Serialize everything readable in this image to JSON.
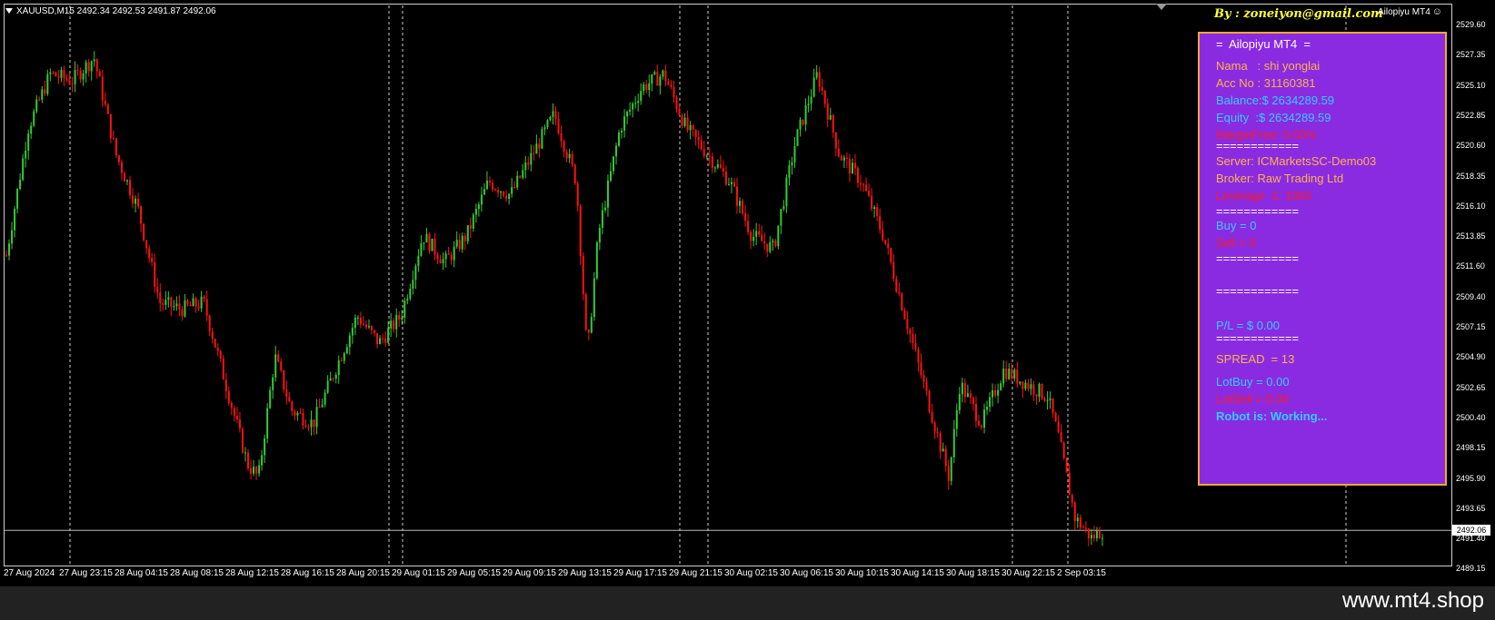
{
  "header": {
    "symbol_info": "XAUUSD,M15  2492.34 2492.53 2491.87 2492.06",
    "ea_name": "Ailopiyu MT4",
    "ea_smile": "☺",
    "by_label": "By : zoneiyon@gmail.com"
  },
  "panel": {
    "title": "=  Ailopiyu MT4  =",
    "nama": "Nama   : shi yonglai",
    "acc_no": "Acc No : 31160381",
    "balance": "Balance:$ 2634289.59",
    "equity": "Equity  :$ 2634289.59",
    "margin_free": "MarginFree: 0.00%",
    "sep1": "============",
    "server": "Server: ICMarketsSC-Demo03",
    "broker": "Broker: Raw Trading Ltd",
    "leverage": "Leverage  1: 1000",
    "sep2": "============",
    "buy": "Buy = 0",
    "sell": "Sell = 0",
    "sep3": "============",
    "sep4": "============",
    "pl": "P/L = $ 0.00",
    "sep5": "============",
    "spread": "SPREAD  = 13",
    "lot_buy": "LotBuy = 0.00",
    "lot_sell": "LotSell = 0.00",
    "robot": "Robot is: Working...",
    "colors": {
      "background": "#8a2be2",
      "border": "#f0a830",
      "orange": "#ffb347",
      "cyan": "#33ccff",
      "red": "#ff1a1a",
      "white": "#ffffff"
    }
  },
  "price_axis": {
    "labels": [
      "2529.60",
      "2527.35",
      "2525.10",
      "2522.85",
      "2520.60",
      "2518.35",
      "2516.10",
      "2513.85",
      "2511.60",
      "2509.40",
      "2507.15",
      "2504.90",
      "2502.65",
      "2500.40",
      "2498.15",
      "2495.90",
      "2493.65",
      "2491.40",
      "2489.15"
    ],
    "current_price": "2492.06"
  },
  "time_axis": {
    "labels": [
      "27 Aug 2024",
      "27 Aug 23:15",
      "28 Aug 04:15",
      "28 Aug 08:15",
      "28 Aug 12:15",
      "28 Aug 16:15",
      "28 Aug 20:15",
      "29 Aug 01:15",
      "29 Aug 05:15",
      "29 Aug 09:15",
      "29 Aug 13:15",
      "29 Aug 17:15",
      "29 Aug 21:15",
      "30 Aug 02:15",
      "30 Aug 06:15",
      "30 Aug 10:15",
      "30 Aug 14:15",
      "30 Aug 18:15",
      "30 Aug 22:15",
      "2 Sep 03:15"
    ]
  },
  "chart": {
    "bull_color": "#33cc33",
    "bear_color": "#ff1111",
    "price_max": 2529.6,
    "price_min": 2489.15,
    "current_price": 2492.06,
    "day_separators": [
      "27 Aug 23:15",
      "29 Aug 01:15",
      "29 Aug 21:15",
      "30 Aug 22:15",
      "2 Sep 03:15"
    ],
    "close_path": [
      [
        0,
        2512.5
      ],
      [
        0.02,
        2522
      ],
      [
        0.04,
        2526
      ],
      [
        0.06,
        2525.5
      ],
      [
        0.08,
        2527.2
      ],
      [
        0.1,
        2520
      ],
      [
        0.12,
        2516
      ],
      [
        0.14,
        2509
      ],
      [
        0.16,
        2508.5
      ],
      [
        0.18,
        2509
      ],
      [
        0.2,
        2503
      ],
      [
        0.22,
        2497
      ],
      [
        0.23,
        2496
      ],
      [
        0.245,
        2505
      ],
      [
        0.26,
        2501
      ],
      [
        0.28,
        2500
      ],
      [
        0.3,
        2504
      ],
      [
        0.32,
        2508
      ],
      [
        0.34,
        2506
      ],
      [
        0.36,
        2508
      ],
      [
        0.38,
        2514
      ],
      [
        0.4,
        2512
      ],
      [
        0.42,
        2514
      ],
      [
        0.44,
        2518
      ],
      [
        0.46,
        2517
      ],
      [
        0.48,
        2520
      ],
      [
        0.5,
        2523
      ],
      [
        0.52,
        2518
      ],
      [
        0.53,
        2505
      ],
      [
        0.54,
        2514
      ],
      [
        0.56,
        2522
      ],
      [
        0.58,
        2525
      ],
      [
        0.6,
        2526
      ],
      [
        0.62,
        2522
      ],
      [
        0.64,
        2520
      ],
      [
        0.66,
        2518
      ],
      [
        0.68,
        2514
      ],
      [
        0.7,
        2513
      ],
      [
        0.72,
        2521
      ],
      [
        0.74,
        2526
      ],
      [
        0.76,
        2520
      ],
      [
        0.78,
        2518
      ],
      [
        0.8,
        2514
      ],
      [
        0.82,
        2508
      ],
      [
        0.84,
        2502
      ],
      [
        0.86,
        2496
      ],
      [
        0.87,
        2503
      ],
      [
        0.89,
        2500
      ],
      [
        0.91,
        2504
      ],
      [
        0.93,
        2503
      ],
      [
        0.95,
        2502
      ],
      [
        0.96,
        2499
      ],
      [
        0.975,
        2493
      ],
      [
        0.99,
        2491.5
      ],
      [
        1.0,
        2492.06
      ]
    ]
  },
  "watermark": "www.mt4.shop"
}
